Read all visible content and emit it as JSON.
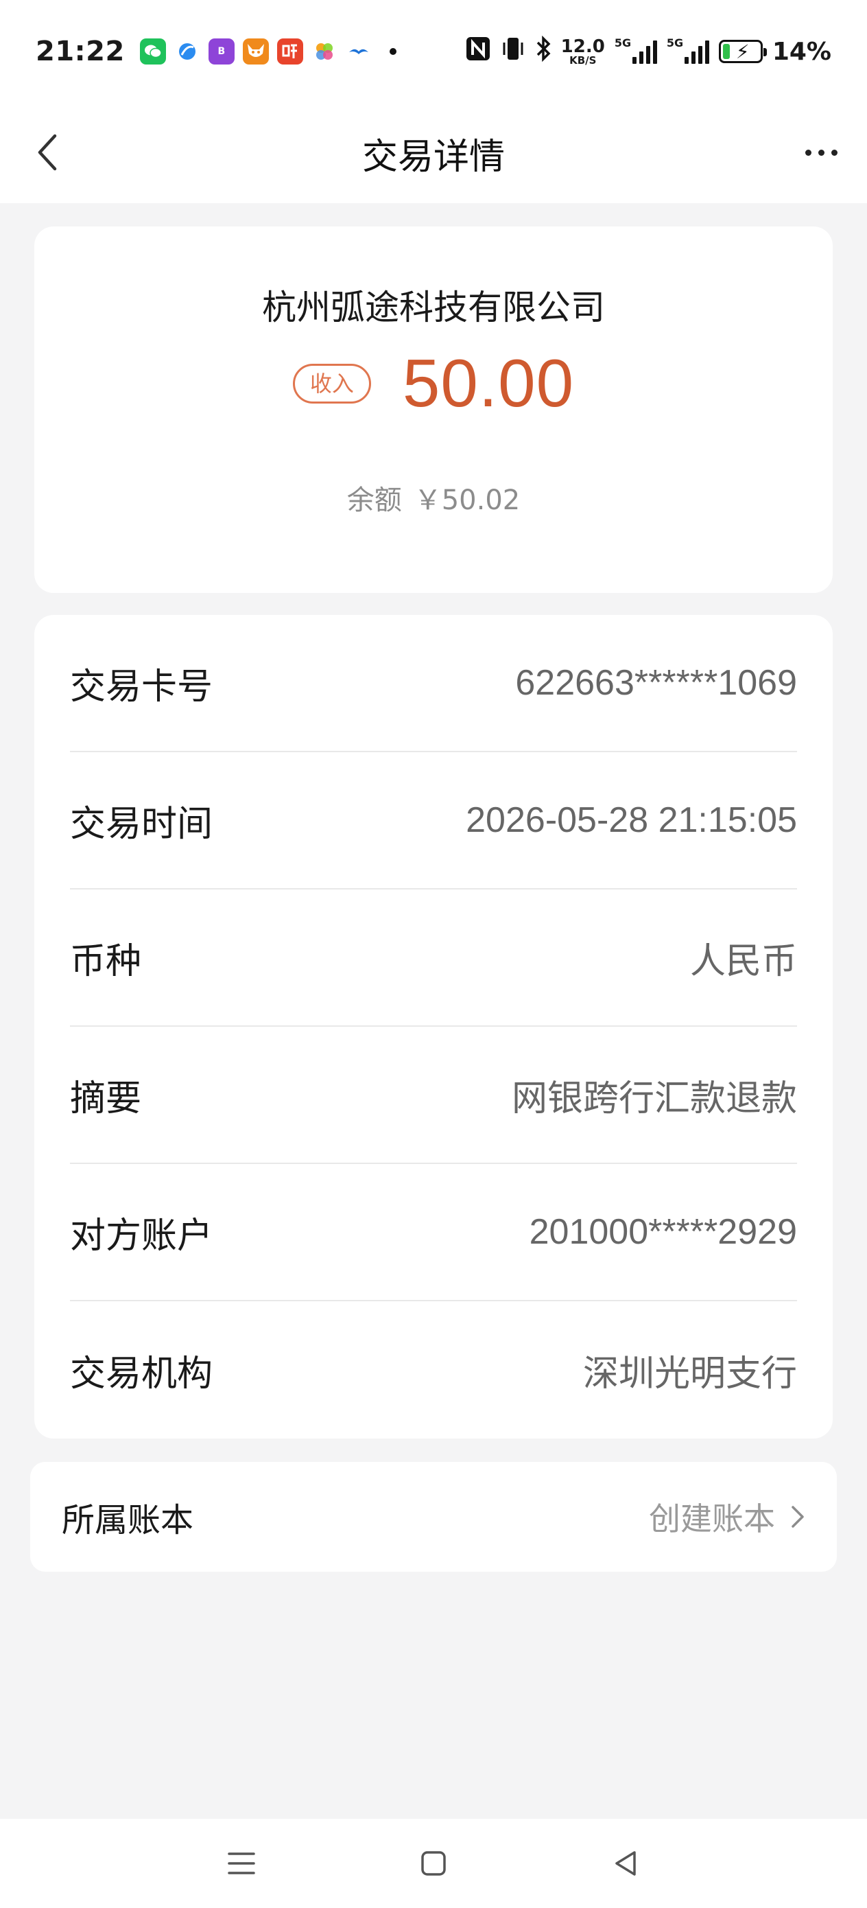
{
  "status_bar": {
    "time": "21:22",
    "notification_icons": [
      "wechat-icon",
      "browser-icon",
      "bank-app-icon",
      "fox-app-icon",
      "listen-app-icon",
      "gallery-app-icon",
      "bird-app-icon",
      "more-dot-icon"
    ],
    "speed_value": "12.0",
    "speed_unit": "KB/S",
    "signal_1_label": "5G",
    "signal_2_label": "5G",
    "battery": "14%",
    "battery_fraction": 0.14
  },
  "header": {
    "title": "交易详情"
  },
  "summary": {
    "merchant": "杭州弧途科技有限公司",
    "type_badge": "收入",
    "amount": "50.00",
    "balance_label": "余额",
    "balance_value": "￥50.02"
  },
  "details": {
    "rows": [
      {
        "label": "交易卡号",
        "value": "622663******1069"
      },
      {
        "label": "交易时间",
        "value": "2026-05-28 21:15:05"
      },
      {
        "label": "币种",
        "value": "人民币"
      },
      {
        "label": "摘要",
        "value": "网银跨行汇款退款"
      },
      {
        "label": "对方账户",
        "value": "201000*****2929"
      },
      {
        "label": "交易机构",
        "value": "深圳光明支行"
      }
    ]
  },
  "ledger": {
    "label": "所属账本",
    "action": "创建账本"
  },
  "colors": {
    "income_accent": "#cf5a2f",
    "badge": "#e0764f",
    "page_bg": "#f4f4f5"
  }
}
